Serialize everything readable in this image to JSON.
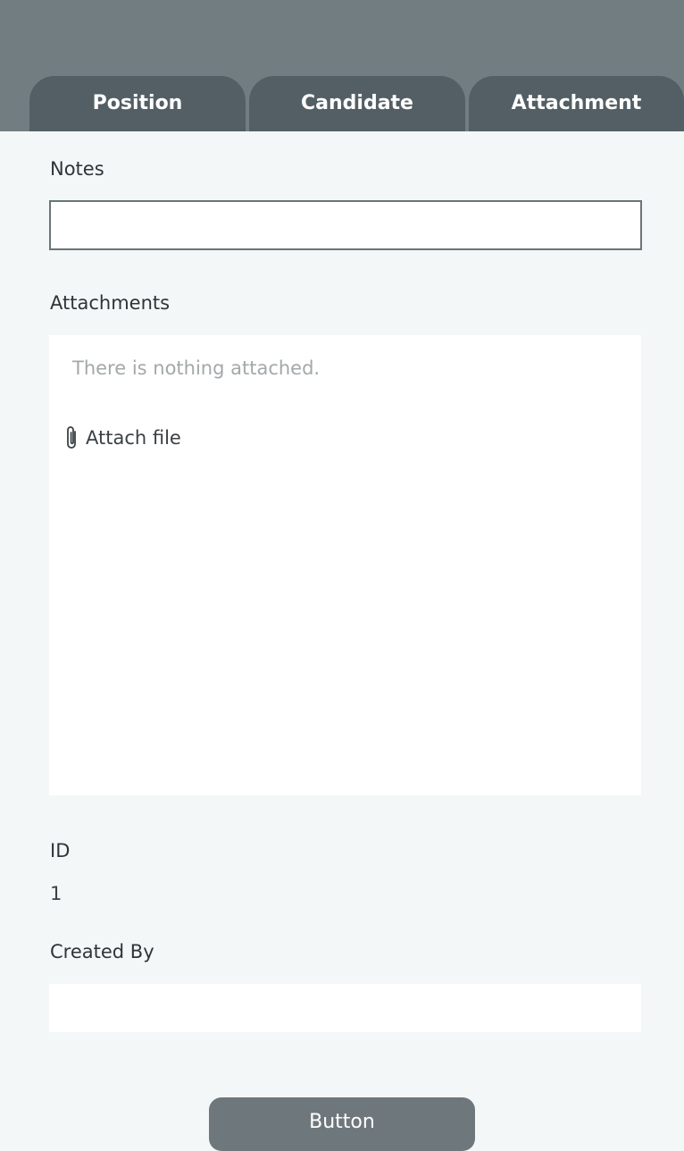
{
  "tabs": [
    {
      "label": "Position"
    },
    {
      "label": "Candidate"
    },
    {
      "label": "Attachment"
    }
  ],
  "form": {
    "notes": {
      "label": "Notes",
      "value": "",
      "placeholder": ""
    },
    "attachments": {
      "label": "Attachments",
      "empty_text": "There is nothing attached.",
      "attach_label": "Attach file",
      "attach_icon": "paperclip-icon"
    },
    "id": {
      "label": "ID",
      "value": "1"
    },
    "created_by": {
      "label": "Created By",
      "value": ""
    }
  },
  "footer": {
    "button_label": "Button"
  },
  "colors": {
    "header": "#727d81",
    "tab": "#535f64",
    "background": "#f4f7f8",
    "button": "#6e787c"
  }
}
